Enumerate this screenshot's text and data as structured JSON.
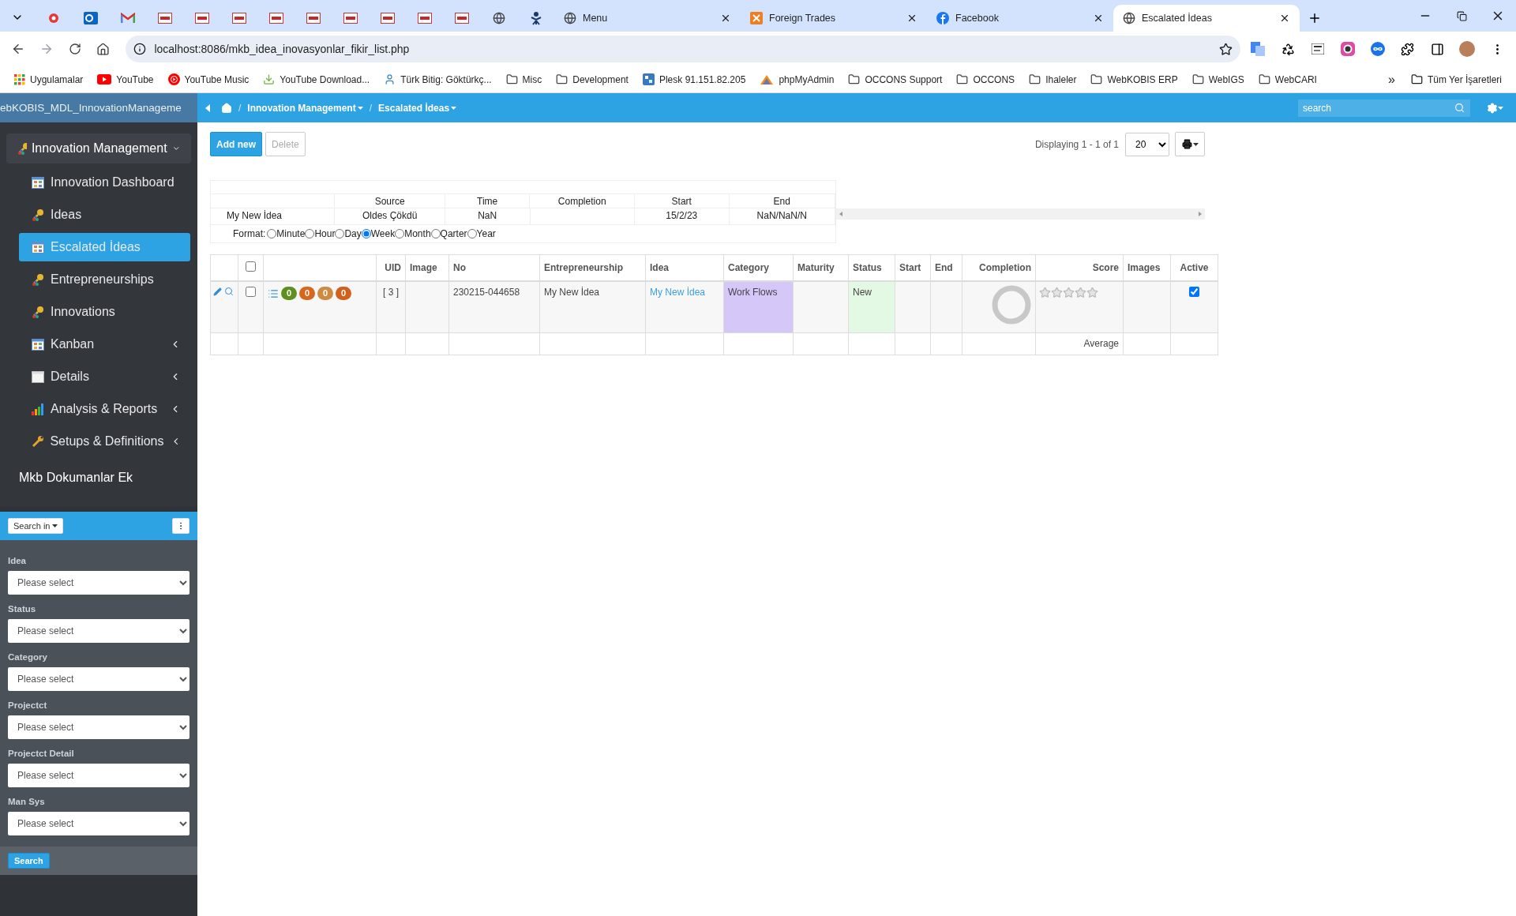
{
  "browser": {
    "tabs": [
      {
        "kind": "record",
        "selected": false
      },
      {
        "kind": "mail-square",
        "selected": false
      },
      {
        "kind": "envelope",
        "selected": false
      },
      {
        "kind": "logo",
        "selected": false
      },
      {
        "kind": "logo",
        "selected": false
      },
      {
        "kind": "logo",
        "selected": false
      },
      {
        "kind": "logo",
        "selected": false
      },
      {
        "kind": "logo",
        "selected": false
      },
      {
        "kind": "logo",
        "selected": false
      },
      {
        "kind": "logo",
        "selected": false
      },
      {
        "kind": "logo",
        "selected": false
      },
      {
        "kind": "logo",
        "selected": false
      },
      {
        "kind": "globe",
        "selected": false
      },
      {
        "kind": "figure",
        "selected": false
      },
      {
        "kind": "globe",
        "title": "Menu",
        "selected": false
      },
      {
        "kind": "orange",
        "title": "Foreign Trades",
        "selected": false
      },
      {
        "kind": "facebook",
        "title": "Facebook",
        "selected": false
      },
      {
        "kind": "globe",
        "title": "Escalated İdeas",
        "selected": true
      }
    ],
    "address": "localhost:8086/mkb_idea_inovasyonlar_fikir_list.php",
    "bookmarks": [
      {
        "kind": "apps",
        "label": "Uygulamalar"
      },
      {
        "kind": "video",
        "label": "YouTube"
      },
      {
        "kind": "music",
        "label": "YouTube Music"
      },
      {
        "kind": "download",
        "label": "YouTube Download..."
      },
      {
        "kind": "person",
        "label": "Türk Bitig: Göktürkç..."
      },
      {
        "kind": "folder",
        "label": "Misc"
      },
      {
        "kind": "folder",
        "label": "Development"
      },
      {
        "kind": "server",
        "label": "Plesk 91.151.82.205"
      },
      {
        "kind": "db",
        "label": "phpMyAdmin"
      },
      {
        "kind": "folder",
        "label": "OCCONS Support"
      },
      {
        "kind": "folder",
        "label": "OCCONS"
      },
      {
        "kind": "folder",
        "label": "Ihaleler"
      },
      {
        "kind": "folder",
        "label": "WebKOBIS ERP"
      },
      {
        "kind": "folder",
        "label": "WebIGS"
      },
      {
        "kind": "folder",
        "label": "WebCARI"
      }
    ],
    "more_bookmarks": "»",
    "all_bookmarks": "Tüm Yer İşaretleri"
  },
  "sidebar": {
    "app_title": "ebKOBIS_MDL_InnovationManageme",
    "menu": [
      {
        "kind": "key",
        "label": "Innovation Management",
        "expanded": true,
        "children": [
          {
            "kind": "grid",
            "label": "Innovation Dashboard",
            "selected": false,
            "submenu": false
          },
          {
            "kind": "key",
            "label": "Ideas",
            "selected": false,
            "submenu": false
          },
          {
            "kind": "grid",
            "label": "Escalated İdeas",
            "selected": true,
            "submenu": false
          },
          {
            "kind": "key",
            "label": "Entrepreneurships",
            "selected": false,
            "submenu": false
          },
          {
            "kind": "key",
            "label": "Innovations",
            "selected": false,
            "submenu": false
          },
          {
            "kind": "grid",
            "label": "Kanban",
            "selected": false,
            "submenu": true
          },
          {
            "kind": "window",
            "label": "Details",
            "selected": false,
            "submenu": true
          },
          {
            "kind": "chart",
            "label": "Analysis & Reports",
            "selected": false,
            "submenu": true
          },
          {
            "kind": "wrench",
            "label": "Setups & Definitions",
            "selected": false,
            "submenu": true
          }
        ]
      },
      {
        "kind": "plain",
        "label": "Mkb Dokumanlar Ek",
        "expanded": false
      }
    ],
    "search_panel": {
      "search_in": "Search in",
      "filters": [
        {
          "label": "Idea",
          "placeholder": "Please select"
        },
        {
          "label": "Status",
          "placeholder": "Please select"
        },
        {
          "label": "Category",
          "placeholder": "Please select"
        },
        {
          "label": "Projectct",
          "placeholder": "Please select"
        },
        {
          "label": "Projectct Detail",
          "placeholder": "Please select"
        },
        {
          "label": "Man Sys",
          "placeholder": "Please select"
        }
      ],
      "search_button": "Search"
    }
  },
  "topbar": {
    "separator": "/",
    "breadcrumbs": [
      "Innovation Management",
      "Escalated İdeas"
    ],
    "search": {
      "placeholder": "search"
    }
  },
  "toolbar": {
    "add": "Add new",
    "delete": {
      "label": "Delete",
      "disabled": true
    },
    "displaying": "Displaying 1 - 1 of 1",
    "page_size": "20"
  },
  "gantt": {
    "columns": [
      "Source",
      "Time",
      "Completion",
      "Start",
      "End"
    ],
    "row": {
      "title": "My New İdea",
      "source": "Oldes Çökdü",
      "time": "NaN",
      "start": "15/2/23",
      "end": "NaN/NaN/N"
    },
    "format_label": "Format:",
    "formats": [
      {
        "label": "Minute",
        "selected": false
      },
      {
        "label": "Hour",
        "selected": false
      },
      {
        "label": "Day",
        "selected": false
      },
      {
        "label": "Week",
        "selected": true
      },
      {
        "label": "Month",
        "selected": false
      },
      {
        "label": "Qarter",
        "selected": false
      },
      {
        "label": "Year",
        "selected": false
      }
    ]
  },
  "grid": {
    "select_all_checked": false,
    "columns": [
      "UID",
      "Image",
      "No",
      "Entrepreneurship",
      "Idea",
      "Category",
      "Maturity",
      "Status",
      "Start",
      "End",
      "Completion",
      "Score",
      "Images",
      "Active"
    ],
    "rows": [
      {
        "checked": false,
        "badges": [
          {
            "label": "0",
            "color": "#5f8f1f"
          },
          {
            "label": "0",
            "color": "#d9661f"
          },
          {
            "label": "0",
            "color": "#cf8a40"
          },
          {
            "label": "0",
            "color": "#d0601c"
          }
        ],
        "uid": "[ 3 ]",
        "no": "230215-044658",
        "entrepreneurship": "My New İdea",
        "idea": "My New İdea",
        "category": {
          "label": "Work Flows",
          "color": "#d6c7f9"
        },
        "status": {
          "label": "New",
          "color": "#e3f9e3"
        },
        "stars": 0,
        "active": true
      }
    ],
    "footer": {
      "score": "Average"
    }
  }
}
